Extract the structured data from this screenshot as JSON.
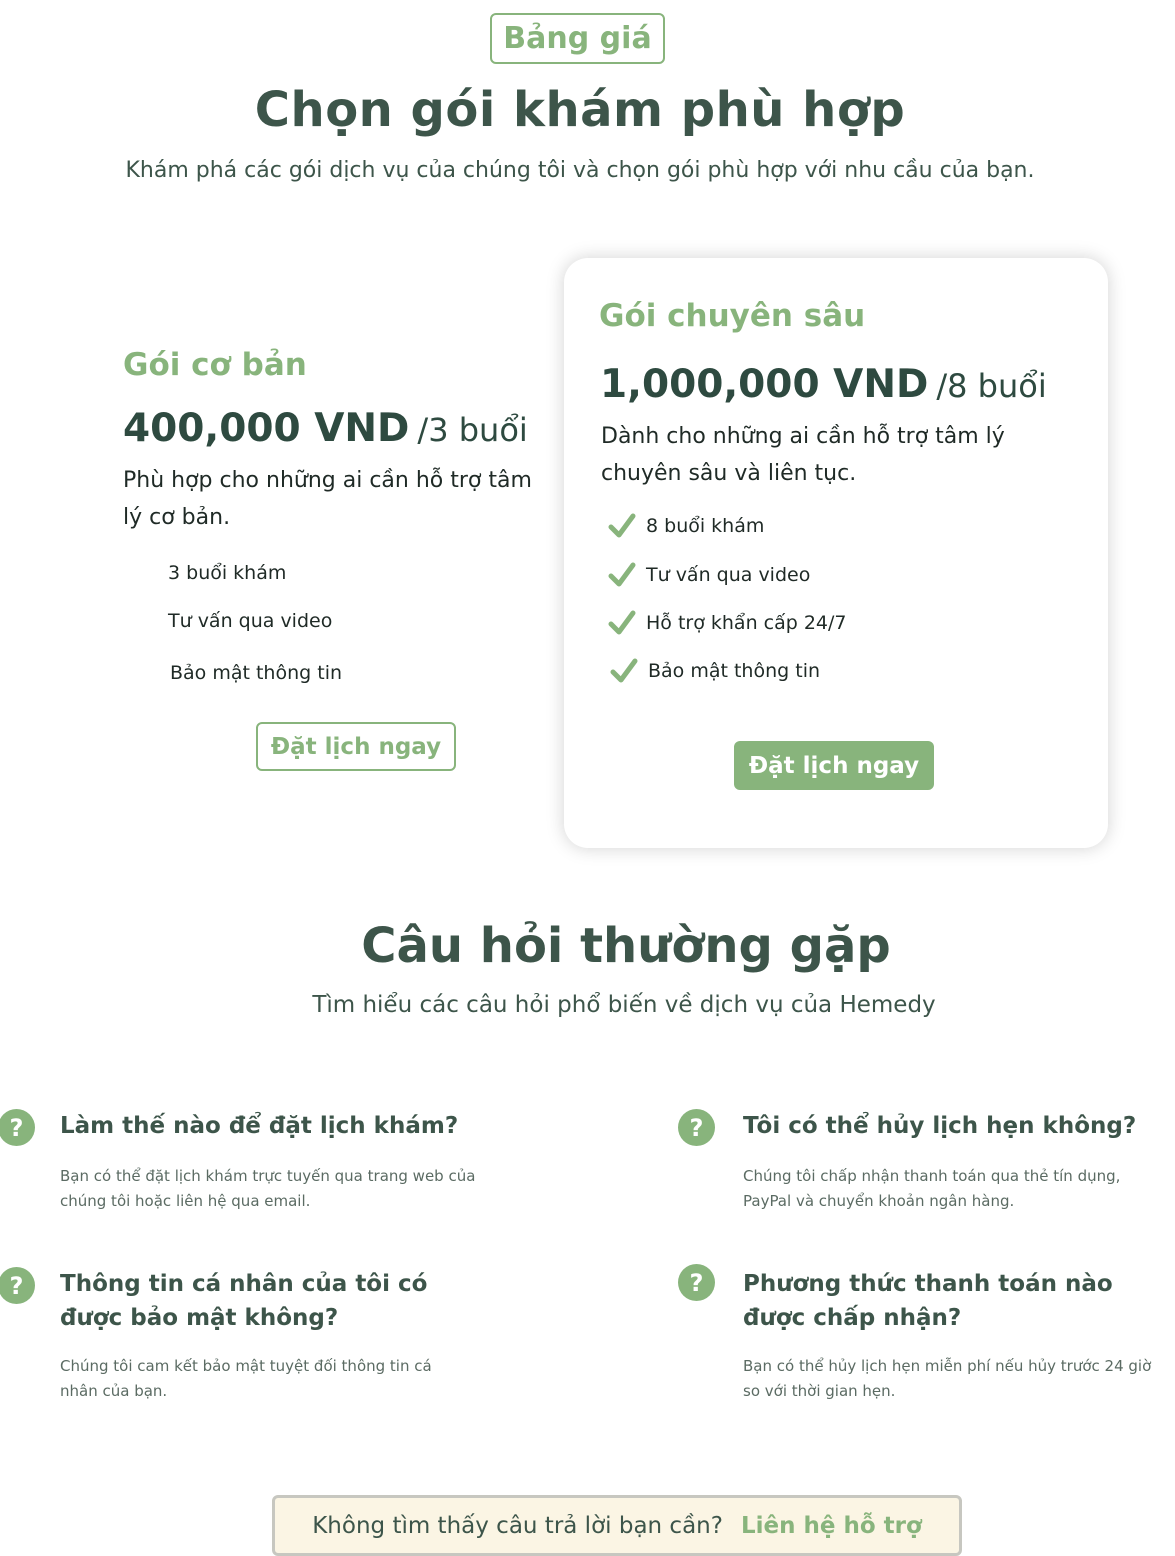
{
  "pricing": {
    "badge": "Bảng giá",
    "title": "Chọn gói khám phù hợp",
    "subtitle": "Khám phá các gói dịch vụ của chúng tôi và chọn gói phù hợp với nhu cầu của bạn."
  },
  "plans": {
    "basic": {
      "name": "Gói cơ bản",
      "price": "400,000 VND",
      "period": "/3 buổi",
      "description": "Phù hợp cho những ai cần hỗ trợ tâm lý cơ bản.",
      "features": [
        "3 buổi khám",
        "Tư vấn qua video",
        "Bảo mật thông tin"
      ],
      "button_label": "Đặt lịch ngay"
    },
    "premium": {
      "name": "Gói chuyên sâu",
      "price": "1,000,000 VND",
      "period": "/8 buổi",
      "description": "Dành cho những ai cần hỗ trợ tâm lý chuyên sâu và liên tục.",
      "features": [
        "8 buổi khám",
        "Tư vấn qua video",
        "Hỗ trợ khẩn cấp 24/7",
        "Bảo mật thông tin"
      ],
      "button_label": "Đặt lịch ngay"
    }
  },
  "faq": {
    "title": "Câu hỏi thường gặp",
    "subtitle": "Tìm hiểu các câu hỏi phổ biến về dịch vụ của Hemedy",
    "icon_glyph": "?",
    "items": [
      {
        "question": "Làm thế nào để đặt lịch khám?",
        "answer": "Bạn có thể đặt lịch khám trực tuyến qua trang web của chúng tôi hoặc liên hệ qua email."
      },
      {
        "question": "Tôi có thể hủy lịch hẹn không?",
        "answer": "Chúng tôi chấp nhận thanh toán qua thẻ tín dụng, PayPal và chuyển khoản ngân hàng."
      },
      {
        "question": "Thông tin cá nhân của tôi có được bảo mật không?",
        "answer": "Chúng tôi cam kết bảo mật tuyệt đối thông tin cá nhân của bạn."
      },
      {
        "question": "Phương thức thanh toán nào được chấp nhận?",
        "answer": "Bạn có thể hủy lịch hẹn miễn phí nếu hủy trước 24 giờ so với thời gian hẹn."
      }
    ]
  },
  "contact": {
    "text": "Không tìm thấy câu trả lời bạn cần?",
    "link_label": "Liên hệ hỗ trợ"
  },
  "colors": {
    "accent": "#88b47c",
    "heading": "#3d554a",
    "contact_bg": "#fbf5e4"
  }
}
